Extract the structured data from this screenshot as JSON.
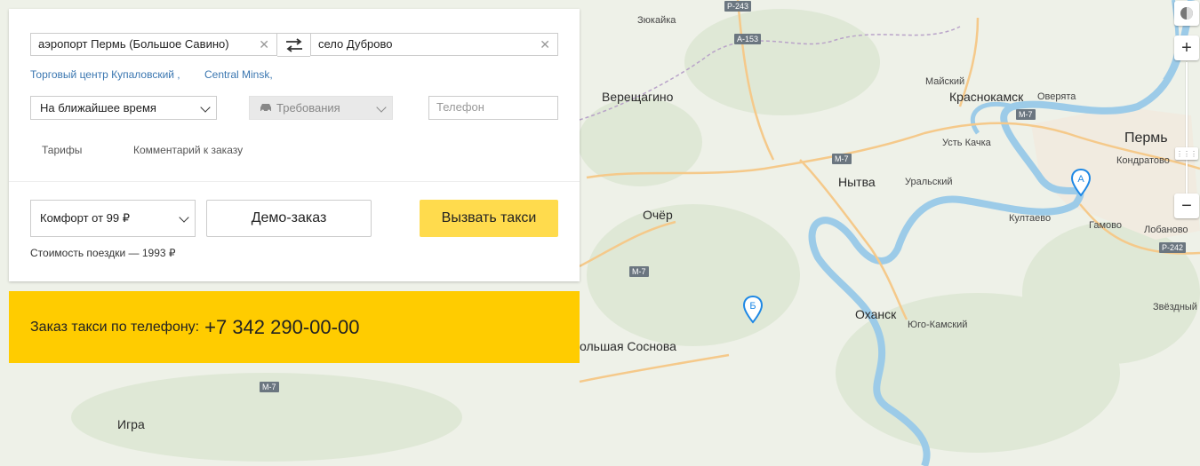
{
  "form": {
    "from_value": "аэропорт Пермь (Большое Савино)",
    "to_value": "село Дуброво",
    "hints": [
      "Торговый центр Купаловский ,",
      "Central Minsk,"
    ],
    "time_select": "На ближайшее время",
    "requirements_placeholder": "Требования",
    "phone_placeholder": "Телефон",
    "tabs": [
      "Тарифы",
      "Комментарий к заказу"
    ],
    "tariff_select": "Комфорт от 99 ₽",
    "demo_button": "Демо-заказ",
    "call_button": "Вызвать такси",
    "cost_text": "Стоимость поездки — 1993 ₽"
  },
  "banner": {
    "label": "Заказ такси по телефону:",
    "phone": "+7 342 290-00-00"
  },
  "map": {
    "cities": {
      "zyukaika": "Зюкайка",
      "vereshchagino": "Верещагино",
      "maysky": "Майский",
      "krasnokamsk": "Краснокамск",
      "overyata": "Оверята",
      "ust_kachka": "Усть Качка",
      "perm": "Пермь",
      "kondratovo": "Кондратово",
      "nytva": "Нытва",
      "uralsky": "Уральский",
      "kultaevo": "Култаево",
      "gamovo": "Гамово",
      "lobanovo": "Лобаново",
      "ocher": "Очёр",
      "okhansk": "Оханск",
      "yugo_kamsky": "Юго-Камский",
      "bolshaya_sosnova": "ольшая Соснова",
      "zvyozdny": "Звёздный",
      "igra": "Игра"
    },
    "roads": {
      "r243": "Р-243",
      "a153": "А-153",
      "m7_a": "М-7",
      "m7_b": "М-7",
      "m7_c": "М-7",
      "m7_d": "М-7",
      "r242": "Р-242"
    },
    "pins": {
      "a": "А",
      "b": "Б"
    },
    "zoom_in": "+",
    "zoom_out": "−",
    "colors": {
      "water": "#9ccbe8",
      "road": "#f5c98a",
      "land": "#eef1e8",
      "pin": "#1e88e5"
    }
  }
}
